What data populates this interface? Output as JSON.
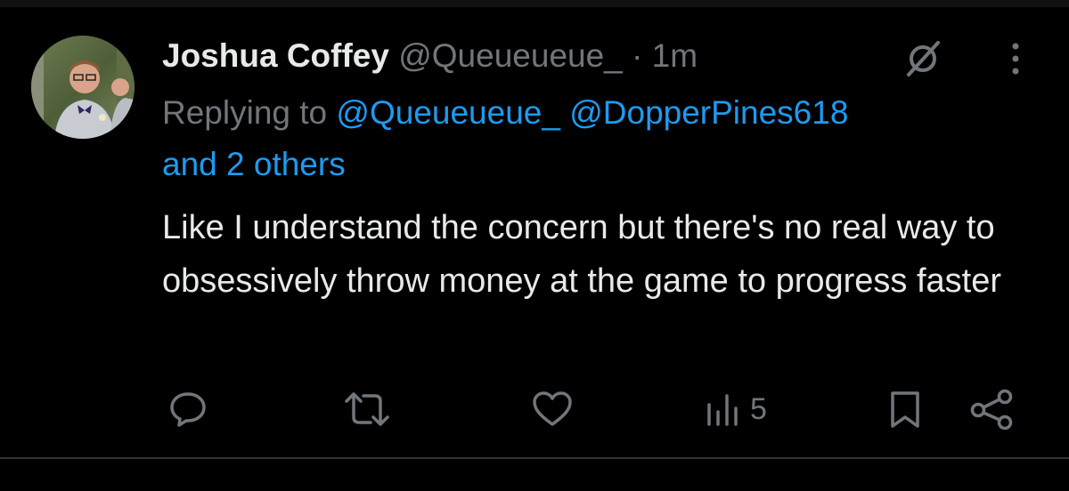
{
  "tweet": {
    "author": {
      "display_name": "Joshua Coffey",
      "handle": "@Queueueue_"
    },
    "separator": "·",
    "time": "1m",
    "replying_label": "Replying to",
    "mentions": [
      "@Queueueue_",
      "@DopperPines618",
      "and 2 others"
    ],
    "text": "Like I understand the concern but there's no real way to obsessively throw money at the game to progress faster"
  },
  "actions": {
    "reply_icon": "reply-icon",
    "retweet_icon": "retweet-icon",
    "like_icon": "heart-icon",
    "views_icon": "views-icon",
    "views_count": "5",
    "bookmark_icon": "bookmark-icon",
    "share_icon": "share-icon"
  },
  "colors": {
    "background": "#000000",
    "primary_text": "#e7e9ea",
    "secondary_text": "#71767b",
    "accent": "#1d9bf0"
  }
}
